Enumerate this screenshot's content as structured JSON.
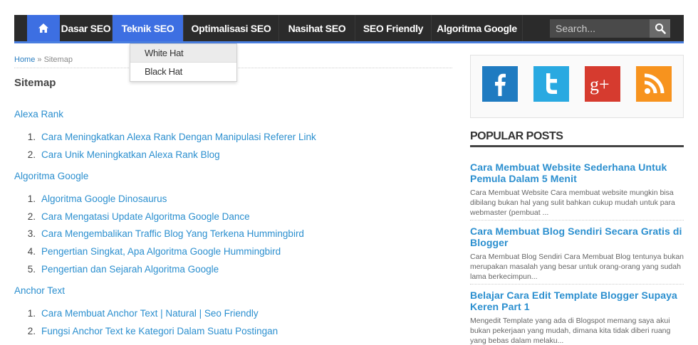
{
  "nav": {
    "home_icon": "home-icon",
    "items": [
      {
        "label": "Dasar SEO"
      },
      {
        "label": "Teknik SEO"
      },
      {
        "label": "Optimalisasi SEO"
      },
      {
        "label": "Nasihat SEO"
      },
      {
        "label": "SEO Friendly"
      },
      {
        "label": "Algoritma Google"
      }
    ],
    "active_index": 1,
    "search_placeholder": "Search...",
    "search_icon": "search-icon",
    "accent_color": "#3d6fe2"
  },
  "dropdown": {
    "items": [
      {
        "label": "White Hat"
      },
      {
        "label": "Black Hat"
      }
    ]
  },
  "breadcrumb": {
    "home": "Home",
    "separator": "»",
    "current": "Sitemap"
  },
  "page_title": "Sitemap",
  "sitemap": [
    {
      "category": "Alexa Rank",
      "posts": [
        {
          "num": "1.",
          "title": "Cara Meningkatkan Alexa Rank Dengan Manipulasi Referer Link"
        },
        {
          "num": "2.",
          "title": "Cara Unik Meningkatkan Alexa Rank Blog"
        }
      ]
    },
    {
      "category": "Algoritma Google",
      "posts": [
        {
          "num": "1.",
          "title": "Algoritma Google Dinosaurus"
        },
        {
          "num": "2.",
          "title": "Cara Mengatasi Update Algoritma Google Dance"
        },
        {
          "num": "3.",
          "title": "Cara Mengembalikan Traffic Blog Yang Terkena Hummingbird"
        },
        {
          "num": "4.",
          "title": "Pengertian Singkat, Apa Algoritma Google Hummingbird"
        },
        {
          "num": "5.",
          "title": "Pengertian dan Sejarah Algoritma Google"
        }
      ]
    },
    {
      "category": "Anchor Text",
      "posts": [
        {
          "num": "1.",
          "title": "Cara Membuat Anchor Text | Natural | Seo Friendly"
        },
        {
          "num": "2.",
          "title": "Fungsi Anchor Text ke Kategori Dalam Suatu Postingan"
        }
      ]
    }
  ],
  "social": [
    {
      "name": "facebook-icon",
      "glyph": "f",
      "color": "#1f7bc1"
    },
    {
      "name": "twitter-icon",
      "glyph": "t",
      "color": "#29a9e1"
    },
    {
      "name": "google-plus-icon",
      "glyph": "g+",
      "color": "#d63b2f"
    },
    {
      "name": "rss-icon",
      "glyph": "rss",
      "color": "#f7931e"
    }
  ],
  "popular": {
    "heading": "POPULAR POSTS",
    "posts": [
      {
        "title": "Cara Membuat Website Sederhana Untuk Pemula Dalam 5 Menit",
        "excerpt": "Cara Membuat Website Cara membuat website mungkin bisa dibilang bukan hal yang sulit bahkan cukup mudah untuk para webmaster (pembuat ..."
      },
      {
        "title": "Cara Membuat Blog Sendiri Secara Gratis di Blogger",
        "excerpt": "Cara Membuat Blog Sendiri Cara Membuat Blog tentunya bukan merupakan masalah yang besar untuk orang-orang yang sudah lama berkecimpun..."
      },
      {
        "title": "Belajar Cara Edit Template Blogger Supaya Keren Part 1",
        "excerpt": "Mengedit Template yang ada di Blogspot memang saya akui bukan pekerjaan yang mudah, dimana kita tidak diberi ruang yang bebas dalam melaku..."
      }
    ]
  }
}
